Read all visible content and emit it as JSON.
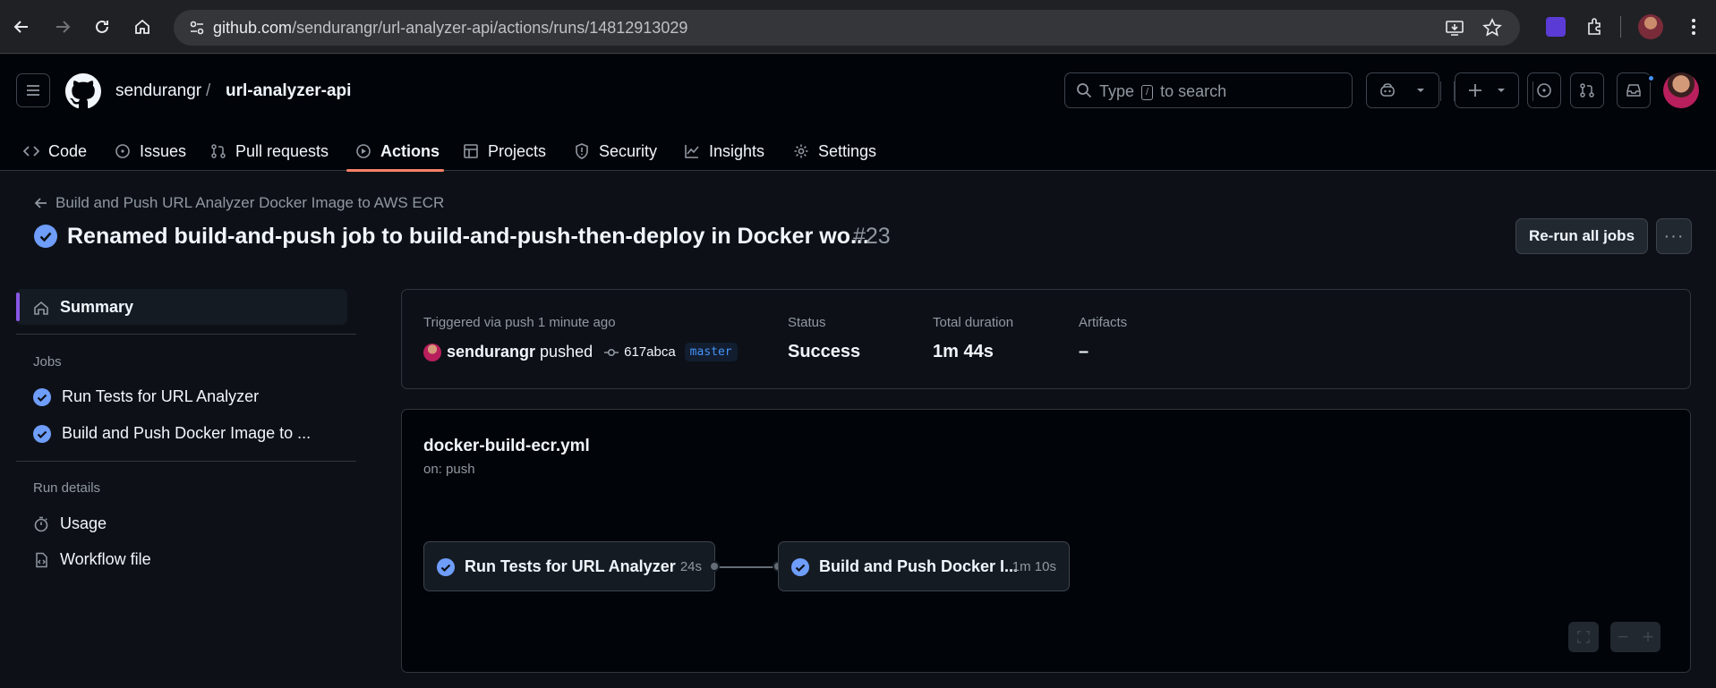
{
  "browser": {
    "url_domain": "github.com",
    "url_path": "/sendurangr/url-analyzer-api/actions/runs/14812913029"
  },
  "header": {
    "owner": "sendurangr",
    "separator": "/",
    "repo": "url-analyzer-api",
    "search_prefix": "Type",
    "search_key": "/",
    "search_suffix": "to search"
  },
  "tabs": [
    {
      "label": "Code",
      "icon": "code-icon"
    },
    {
      "label": "Issues",
      "icon": "issue-icon"
    },
    {
      "label": "Pull requests",
      "icon": "pull-request-icon"
    },
    {
      "label": "Actions",
      "icon": "play-icon",
      "active": true
    },
    {
      "label": "Projects",
      "icon": "table-icon"
    },
    {
      "label": "Security",
      "icon": "shield-icon"
    },
    {
      "label": "Insights",
      "icon": "graph-icon"
    },
    {
      "label": "Settings",
      "icon": "gear-icon"
    }
  ],
  "run": {
    "back_label": "Build and Push URL Analyzer Docker Image to AWS ECR",
    "title": "Renamed build-and-push job to build-and-push-then-deploy in Docker wo...",
    "number": "#23",
    "rerun_label": "Re-run all jobs",
    "more_label": "···"
  },
  "sidebar": {
    "summary_label": "Summary",
    "jobs_heading": "Jobs",
    "jobs": [
      {
        "label": "Run Tests for URL Analyzer"
      },
      {
        "label": "Build and Push Docker Image to ..."
      }
    ],
    "run_details_heading": "Run details",
    "details": [
      {
        "label": "Usage",
        "icon": "stopwatch-icon"
      },
      {
        "label": "Workflow file",
        "icon": "file-code-icon"
      }
    ]
  },
  "summary": {
    "triggered_label": "Triggered via push 1 minute ago",
    "actor": "sendurangr",
    "action": "pushed",
    "commit": "617abca",
    "branch": "master",
    "status_label": "Status",
    "status_value": "Success",
    "duration_label": "Total duration",
    "duration_value": "1m 44s",
    "artifacts_label": "Artifacts",
    "artifacts_value": "–"
  },
  "workflow": {
    "file": "docker-build-ecr.yml",
    "on": "on: push",
    "jobs": [
      {
        "name": "Run Tests for URL Analyzer",
        "time": "24s"
      },
      {
        "name": "Build and Push Docker I...",
        "time": "1m 10s"
      }
    ]
  },
  "colors": {
    "success": "#6e9dfa",
    "accent_underline": "#f78166",
    "active_bar": "#8957e5"
  }
}
